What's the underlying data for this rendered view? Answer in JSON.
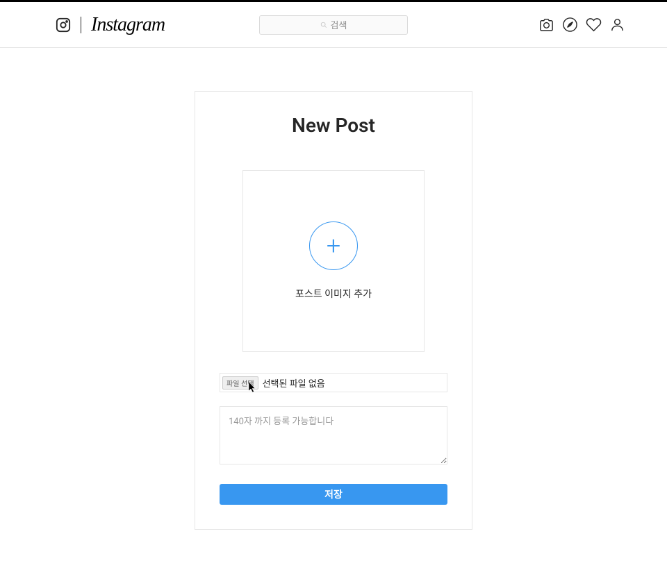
{
  "header": {
    "brand_name": "Instagram",
    "search_placeholder": "검색"
  },
  "card": {
    "title": "New Post",
    "upload_label": "포스트 이미지 추가",
    "file_button_label": "파일 선택",
    "file_status": "선택된 파일 없음",
    "caption_placeholder": "140자 까지 등록 가능합니다",
    "save_button_label": "저장"
  }
}
